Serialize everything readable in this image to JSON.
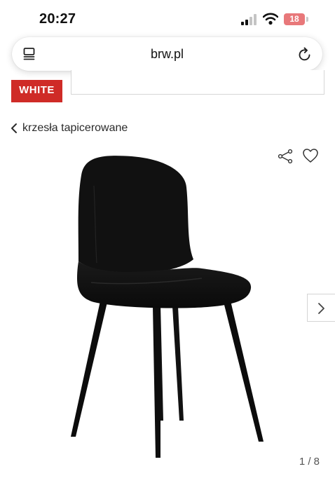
{
  "status_bar": {
    "time": "20:27",
    "battery_level": "18",
    "icons": [
      "signal-icon",
      "wifi-icon",
      "battery-icon"
    ],
    "battery_color": "#e8787a"
  },
  "browser": {
    "url": "brw.pl",
    "icons": [
      "tabs-icon",
      "reload-icon"
    ]
  },
  "site_header": {
    "logo_text": "WHITE",
    "logo_color": "#cf2b27"
  },
  "breadcrumb": {
    "label": "krzesła tapicerowane",
    "icon": "chevron-left-icon"
  },
  "gallery": {
    "image_name": "black-velvet-chair",
    "counter": "1 / 8",
    "current": 1,
    "total": 8,
    "icons": [
      "share-icon",
      "heart-icon",
      "chevron-right-icon"
    ]
  }
}
